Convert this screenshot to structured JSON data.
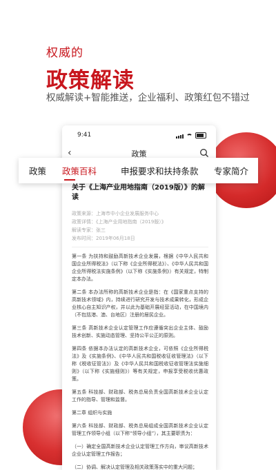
{
  "hero": {
    "subtitle": "权威的",
    "title": "政策解读",
    "description": "权威解读+智能推送，企业福利、政策红包不错过"
  },
  "phone": {
    "status_time": "9:41",
    "nav_title": "政策",
    "back_icon": "chevron-left-icon",
    "search_icon": "search-icon"
  },
  "tabs": [
    {
      "label": "政策",
      "active": false
    },
    {
      "label": "政策百科",
      "active": true
    },
    {
      "label": "申报要求和扶持条款",
      "active": false
    },
    {
      "label": "专家简介",
      "active": false
    }
  ],
  "article": {
    "title": "关于《上海产业用地指南（2019版）》的解读",
    "meta": [
      "政策来源：上海市中小企业发展服务中心",
      "政策详情：《上海产业用地指南（2019版）》",
      "解读专家：张三",
      "发布时间：2019年06月18日"
    ],
    "paragraphs": [
      "第一条 为扶持和鼓励高新技术企业发展，根据《中华人民共和国企业所得税法》（以下称《企业所得税法》）、《中华人民共和国企业所得税法实施条例》（以下称《实施条例》）有关规定，特制定本办法。",
      "第二条 本办法所称的高新技术企业是指：在《国家重点支持的高新技术领域》内，持续进行研究开发与技术成果转化，形成企业核心自主知识产权，并以此为基础开展经营活动，在中国境内（不包括港、澳、台地区）注册的居民企业。",
      "第三条 高新技术企业认定管理工作应遵循突出企业主体、鼓励技术创新、实施动态管理、坚持公平公正的原则。",
      "第四条 依据本办法认定的高新技术企业，可依照《企业所得税法》及《实施条例》、《中华人民共和国税收征收管理法》（以下称《税收征管法》）及《中华人民共和国税收征收管理法实施细则》（以下称《实施细则》）等有关规定，申报享受税收优惠政策。",
      "第五条 科技部、财政部、税务总局负责全国高新技术企业认定工作的指导、管理和监督。",
      "第二章 组织与实施",
      "第六条 科技部、财政部、税务总局组成全国高新技术企业认定管理工作领导小组（以下称“领导小组”），其主要职责为：",
      "（一）确定全国高新技术企业认定管理工作方向，审议高新技术企业认定管理工作报告；",
      "（二）协调、解决认定管理及相关政策落实中的重大问题；"
    ]
  },
  "colors": {
    "accent": "#c8161d"
  }
}
